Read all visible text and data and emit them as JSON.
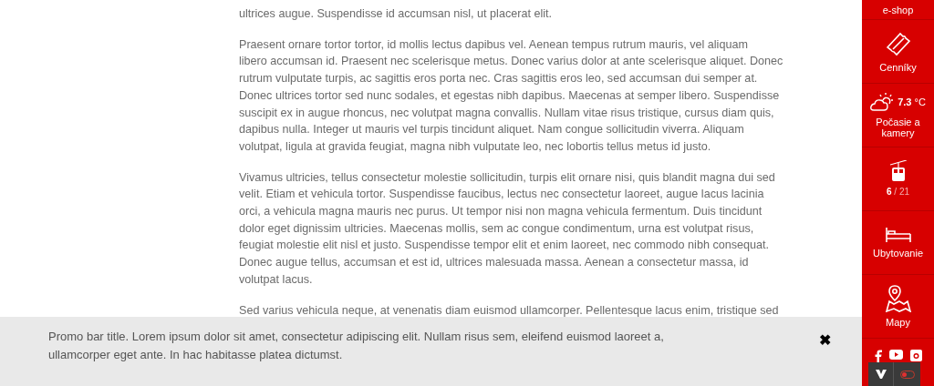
{
  "article": {
    "paragraphs": [
      {
        "lines": [
          "ultrices augue. Suspendisse id accumsan nisl, ut placerat elit."
        ]
      },
      {
        "lines": [
          "Praesent ornare tortor tortor, id mollis lectus dapibus vel. Aenean tempus rutrum mauris, vel aliquam",
          "libero accumsan id. Praesent nec scelerisque metus. Donec varius dolor at ante scelerisque aliquet. Donec",
          "rutrum vulputate turpis, ac sagittis eros porta nec. Cras sagittis eros leo, sed accumsan dui semper at.",
          "Donec ultrices tortor sed nunc sodales, et egestas nibh dapibus. Maecenas at semper libero. Suspendisse",
          "suscipit ex in augue rhoncus, nec volutpat magna convallis. Nullam vitae risus tristique, cursus diam quis,",
          "dapibus nulla. Integer ut mauris vel turpis tincidunt aliquet. Nam congue sollicitudin viverra. Aliquam",
          "volutpat, ligula at gravida feugiat, magna nibh vulputate leo, nec lobortis tellus metus id justo."
        ]
      },
      {
        "lines": [
          "Vivamus ultricies, tellus consectetur molestie sollicitudin, turpis elit ornare nisi, quis blandit magna dui sed",
          "velit. Etiam et vehicula tortor. Suspendisse faucibus, lectus nec consectetur laoreet, augue lacus lacinia",
          "orci, a vehicula magna mauris nec purus. Ut tempor nisi non magna vehicula fermentum. Duis tincidunt",
          "dolor eget dignissim ultricies. Maecenas mollis, sem ac congue condimentum, urna est volutpat risus,",
          "feugiat molestie elit nisl et justo. Suspendisse tempor elit et enim laoreet, nec commodo nibh consequat.",
          "Donec augue tellus, accumsan et est id, ultrices malesuada massa. Aenean a consectetur massa, id",
          "volutpat lacus."
        ]
      },
      {
        "lines": [
          "Sed varius vehicula neque, at venenatis diam euismod ullamcorper. Pellentesque lacus enim, tristique sed"
        ]
      }
    ]
  },
  "sidebar": {
    "items": [
      {
        "kind": "link",
        "label": "e-shop"
      },
      {
        "kind": "tickets",
        "label": "Cenníky"
      },
      {
        "kind": "weather",
        "temperature": "7.3",
        "unit": "°C",
        "label": "Počasie a kamery"
      },
      {
        "kind": "lifts",
        "open": "6",
        "total": "/ 21"
      },
      {
        "kind": "bed",
        "label": "Ubytovanie"
      },
      {
        "kind": "map",
        "label": "Mapy"
      },
      {
        "kind": "social"
      }
    ]
  },
  "promo_bar": {
    "lines": [
      "Promo bar title. Lorem ipsum dolor sit amet, consectetur adipiscing elit. Nullam risus sem, eleifend euismod laoreet a,",
      "ullamcorper eget ante. In hac habitasse platea dictumst."
    ],
    "close": "✖"
  }
}
